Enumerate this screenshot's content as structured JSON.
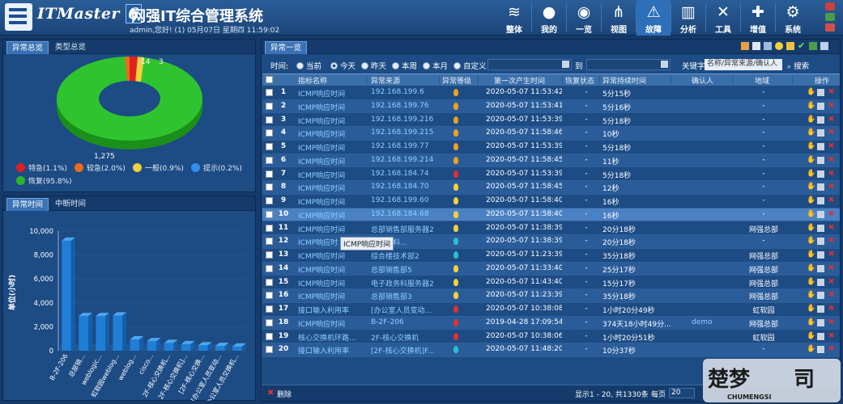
{
  "header": {
    "brand": "ITMaster",
    "brand_version": "6",
    "system_title": "网强IT综合管理系统",
    "welcome": "admin,您好! (1) 05月07日 星期四 11:59:02",
    "nav": [
      {
        "label": "整体",
        "icon": "layers-icon",
        "glyph": "≋"
      },
      {
        "label": "我的",
        "icon": "user-icon",
        "glyph": "●"
      },
      {
        "label": "一览",
        "icon": "globe-icon",
        "glyph": "◉"
      },
      {
        "label": "视图",
        "icon": "network-icon",
        "glyph": "⋔"
      },
      {
        "label": "故障",
        "icon": "warning-icon",
        "glyph": "⚠"
      },
      {
        "label": "分析",
        "icon": "chart-icon",
        "glyph": "▥"
      },
      {
        "label": "工具",
        "icon": "tools-icon",
        "glyph": "✕"
      },
      {
        "label": "增值",
        "icon": "plus-icon",
        "glyph": "✚"
      },
      {
        "label": "系统",
        "icon": "gear-icon",
        "glyph": "⚙"
      }
    ],
    "active_nav": "故障"
  },
  "left_top": {
    "tabs": [
      "异常总览",
      "类型总览"
    ],
    "donut": {
      "labels_visible": [
        "14",
        "3",
        "1,275"
      ],
      "legend": [
        {
          "label": "特急(1.1%)",
          "color": "#e02020"
        },
        {
          "label": "较急(2.0%)",
          "color": "#ee6a1a"
        },
        {
          "label": "一般(0.9%)",
          "color": "#f4d03a"
        },
        {
          "label": "提示(0.2%)",
          "color": "#2f8ff0"
        },
        {
          "label": "恢复(95.8%)",
          "color": "#2bb52b"
        }
      ]
    }
  },
  "left_bottom": {
    "tabs": [
      "异常时间",
      "中断时间"
    ]
  },
  "chart_data": {
    "type": "bar",
    "title": "",
    "xlabel": "",
    "ylabel": "单位(小时)",
    "ylim": [
      0,
      10000
    ],
    "yticks": [
      "0",
      "2,000",
      "4,000",
      "6,000",
      "8,000",
      "10,000"
    ],
    "categories": [
      "B-2F-206",
      "总部销...",
      "weblogic...",
      "虹软园weblog...",
      "weblog...",
      "cisco...",
      "2F-核心交换机...",
      "2F-核心交换机]...",
      "[2F-核心交换...",
      "[办公室人员变动...",
      "[办公室人员交换机..."
    ],
    "values": [
      9200,
      2900,
      2900,
      2950,
      950,
      800,
      650,
      550,
      450,
      400,
      350
    ],
    "color": "#1f7fd6"
  },
  "table": {
    "tab": "异常一览",
    "filter": {
      "time_label": "时间:",
      "options": [
        "当前",
        "今天",
        "昨天",
        "本周",
        "本月",
        "自定义"
      ],
      "selected": "今天",
      "to_label": "到",
      "keyword_label": "关键字",
      "keyword_placeholder": "名称/异常来源/确认人",
      "search_label": "搜索"
    },
    "columns": [
      "指标名称",
      "异常来源",
      "异常等级",
      "第一次产生时间",
      "恢复状态",
      "异常持续时间",
      "确认人",
      "地域",
      "操作"
    ],
    "rows": [
      {
        "n": "1",
        "name": "ICMP响应时间",
        "src": "192.168.199.6",
        "lvl": "#f0a020",
        "time": "2020-05-07 11:53:42",
        "rec": "-",
        "dur": "5分15秒",
        "ack": "",
        "area": "-"
      },
      {
        "n": "2",
        "name": "ICMP响应时间",
        "src": "192.168.199.76",
        "lvl": "#f0a020",
        "time": "2020-05-07 11:53:41",
        "rec": "-",
        "dur": "5分16秒",
        "ack": "",
        "area": "-"
      },
      {
        "n": "3",
        "name": "ICMP响应时间",
        "src": "192.168.199.216",
        "lvl": "#f0a020",
        "time": "2020-05-07 11:53:39",
        "rec": "-",
        "dur": "5分18秒",
        "ack": "",
        "area": "-"
      },
      {
        "n": "4",
        "name": "ICMP响应时间",
        "src": "192.168.199.215",
        "lvl": "#f0a020",
        "time": "2020-05-07 11:58:46",
        "rec": "-",
        "dur": "10秒",
        "ack": "",
        "area": "-"
      },
      {
        "n": "5",
        "name": "ICMP响应时间",
        "src": "192.168.199.77",
        "lvl": "#f0a020",
        "time": "2020-05-07 11:53:39",
        "rec": "-",
        "dur": "5分18秒",
        "ack": "",
        "area": "-"
      },
      {
        "n": "6",
        "name": "ICMP响应时间",
        "src": "192.168.199.214",
        "lvl": "#f0a020",
        "time": "2020-05-07 11:58:45",
        "rec": "-",
        "dur": "11秒",
        "ack": "",
        "area": "-"
      },
      {
        "n": "7",
        "name": "ICMP响应时间",
        "src": "192.168.184.74",
        "lvl": "#e03030",
        "time": "2020-05-07 11:53:39",
        "rec": "-",
        "dur": "5分18秒",
        "ack": "",
        "area": "-"
      },
      {
        "n": "8",
        "name": "ICMP响应时间",
        "src": "192.168.184.70",
        "lvl": "#f4d03a",
        "time": "2020-05-07 11:58:45",
        "rec": "-",
        "dur": "12秒",
        "ack": "",
        "area": "-"
      },
      {
        "n": "9",
        "name": "ICMP响应时间",
        "src": "192.168.199.60",
        "lvl": "#f4d03a",
        "time": "2020-05-07 11:58:40",
        "rec": "-",
        "dur": "16秒",
        "ack": "",
        "area": "-"
      },
      {
        "n": "10",
        "name": "ICMP响应时间",
        "src": "192.168.184.68",
        "lvl": "#f4d03a",
        "time": "2020-05-07 11:58:40",
        "rec": "-",
        "dur": "16秒",
        "ack": "",
        "area": "-"
      },
      {
        "n": "11",
        "name": "ICMP响应时间",
        "src": "总部销售部服务器2",
        "lvl": "#f4d03a",
        "time": "2020-05-07 11:38:39",
        "rec": "-",
        "dur": "20分18秒",
        "ack": "",
        "area": "网强总部"
      },
      {
        "n": "12",
        "name": "ICMP响应时",
        "src": "财务资料...",
        "lvl": "#28c0d0",
        "time": "2020-05-07 11:38:39",
        "rec": "-",
        "dur": "20分18秒",
        "ack": "",
        "area": "-"
      },
      {
        "n": "13",
        "name": "ICMP响应时间",
        "src": "综合楼技术部2",
        "lvl": "#28c0d0",
        "time": "2020-05-07 11:23:39",
        "rec": "-",
        "dur": "35分18秒",
        "ack": "",
        "area": "网强总部"
      },
      {
        "n": "14",
        "name": "ICMP响应时间",
        "src": "总部销售部5",
        "lvl": "#f4d03a",
        "time": "2020-05-07 11:33:40",
        "rec": "-",
        "dur": "25分17秒",
        "ack": "",
        "area": "网强总部"
      },
      {
        "n": "15",
        "name": "ICMP响应时间",
        "src": "电子政务科服务器2",
        "lvl": "#f4d03a",
        "time": "2020-05-07 11:43:40",
        "rec": "-",
        "dur": "15分17秒",
        "ack": "",
        "area": "网强总部"
      },
      {
        "n": "16",
        "name": "ICMP响应时间",
        "src": "总部销售部3",
        "lvl": "#f4d03a",
        "time": "2020-05-07 11:23:39",
        "rec": "-",
        "dur": "35分18秒",
        "ack": "",
        "area": "网强总部"
      },
      {
        "n": "17",
        "name": "接口输入利用率",
        "src": "[办公室人员变动...",
        "lvl": "#e03030",
        "time": "2020-05-07 10:38:08",
        "rec": "-",
        "dur": "1小时20分49秒",
        "ack": "",
        "area": "虹软园"
      },
      {
        "n": "18",
        "name": "ICMP响应时间",
        "src": "B-2F-206",
        "lvl": "#e03030",
        "time": "2019-04-28 17:09:54",
        "rec": "-",
        "dur": "374天18小时49分...",
        "ack": "demo",
        "area": "网强总部"
      },
      {
        "n": "19",
        "name": "核心交换机环路...",
        "src": "2F-核心交换机",
        "lvl": "#e03030",
        "time": "2020-05-07 10:38:06",
        "rec": "-",
        "dur": "1小时20分51秒",
        "ack": "",
        "area": "虹软园"
      },
      {
        "n": "20",
        "name": "接口输入利用率",
        "src": "[2F-核心交换机]F...",
        "lvl": "#28c0d0",
        "time": "2020-05-07 11:48:20",
        "rec": "-",
        "dur": "10分37秒",
        "ack": "",
        "area": "-"
      }
    ],
    "tooltip": "ICMP响应时间",
    "footer": {
      "delete_label": "删除",
      "summary": "显示1 - 20, 共1330条",
      "per_page_label": "每页",
      "per_page": "20"
    }
  }
}
